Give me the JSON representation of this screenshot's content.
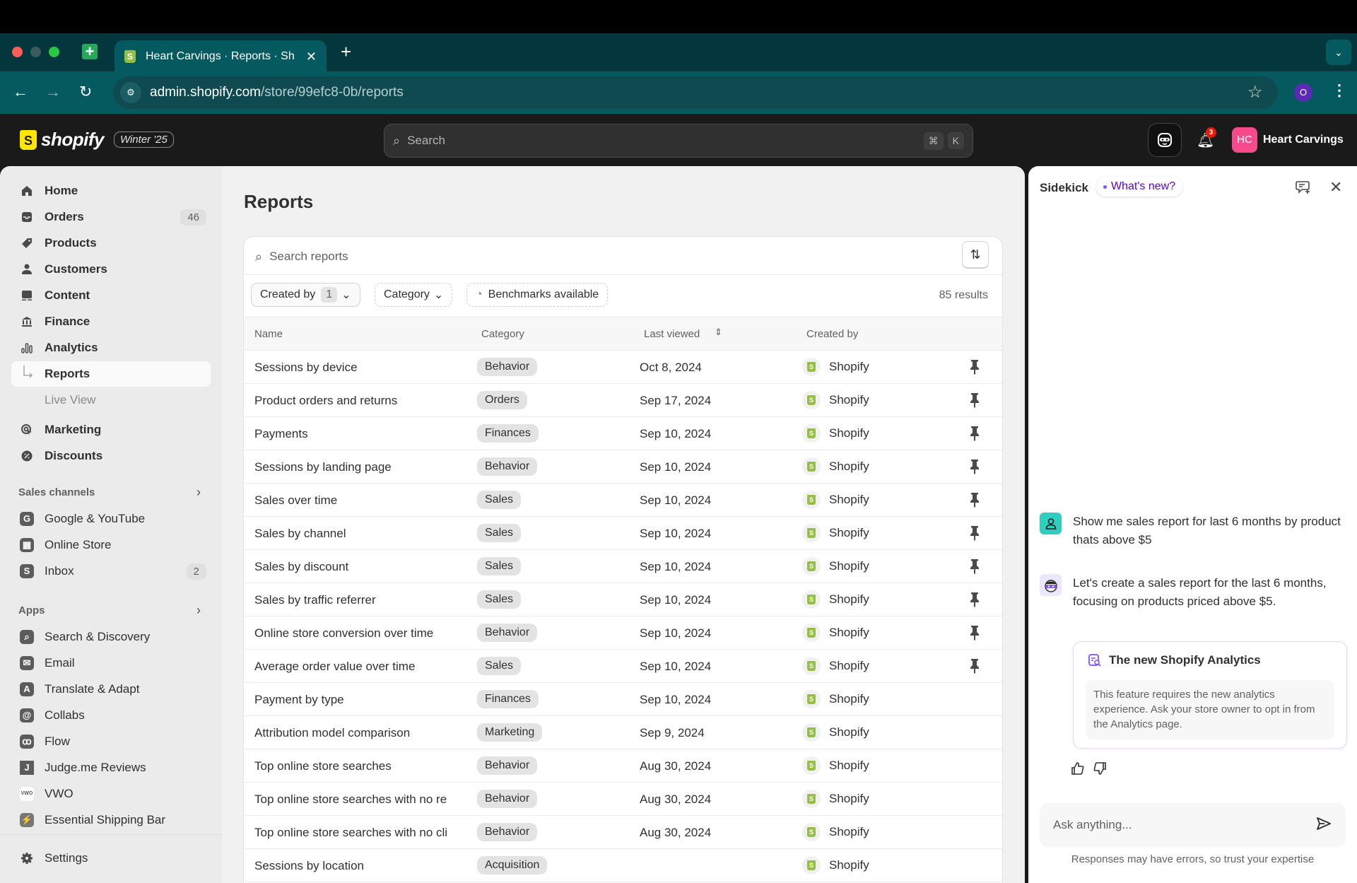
{
  "browser": {
    "tab_title": "Heart Carvings · Reports · Shopify",
    "tab_title_visible": "Heart Carvings · Reports · Sh",
    "new_tab_label": "+",
    "url_domain": "admin.shopify.com",
    "url_path": "/store/99efc8-0b/reports",
    "profile_initial": "O"
  },
  "header": {
    "logo_text": "shopify",
    "edition_badge": "Winter '25",
    "search_placeholder": "Search",
    "shortcut_keys": [
      "⌘",
      "K"
    ],
    "notification_count": "3",
    "store_initials": "HC",
    "store_name": "Heart Carvings"
  },
  "sidebar": {
    "items": [
      {
        "label": "Home",
        "icon": "home-icon"
      },
      {
        "label": "Orders",
        "icon": "orders-icon",
        "count": "46"
      },
      {
        "label": "Products",
        "icon": "tag-icon"
      },
      {
        "label": "Customers",
        "icon": "person-icon"
      },
      {
        "label": "Content",
        "icon": "content-icon"
      },
      {
        "label": "Finance",
        "icon": "bank-icon"
      },
      {
        "label": "Analytics",
        "icon": "bar-chart-icon"
      },
      {
        "label": "Reports",
        "active": true
      },
      {
        "label": "Live View"
      },
      {
        "label": "Marketing",
        "icon": "target-icon"
      },
      {
        "label": "Discounts",
        "icon": "discount-icon"
      }
    ],
    "sales_channels_heading": "Sales channels",
    "sales_channels": [
      {
        "label": "Google & YouTube",
        "icon": "google-icon"
      },
      {
        "label": "Online Store",
        "icon": "store-icon"
      },
      {
        "label": "Inbox",
        "icon": "inbox-icon",
        "count": "2"
      }
    ],
    "apps_heading": "Apps",
    "apps": [
      {
        "label": "Search & Discovery",
        "icon": "search-discovery-icon"
      },
      {
        "label": "Email",
        "icon": "email-icon"
      },
      {
        "label": "Translate & Adapt",
        "icon": "translate-icon"
      },
      {
        "label": "Collabs",
        "icon": "collabs-icon"
      },
      {
        "label": "Flow",
        "icon": "flow-icon"
      },
      {
        "label": "Judge.me Reviews",
        "icon": "judgeme-icon"
      },
      {
        "label": "VWO",
        "icon": "vwo-icon"
      },
      {
        "label": "Essential Shipping Bar",
        "icon": "shipping-bar-icon"
      }
    ],
    "settings_label": "Settings"
  },
  "main": {
    "title": "Reports",
    "search_placeholder": "Search reports",
    "filters": {
      "created_by_label": "Created by",
      "created_by_count": "1",
      "category_label": "Category",
      "benchmarks_label": "Benchmarks available"
    },
    "results_count": "85 results",
    "columns": [
      "Name",
      "Category",
      "Last viewed",
      "Created by"
    ],
    "rows": [
      {
        "name": "Sessions by device",
        "category": "Behavior",
        "last_viewed": "Oct 8, 2024",
        "created_by": "Shopify",
        "pinned": true
      },
      {
        "name": "Product orders and returns",
        "category": "Orders",
        "last_viewed": "Sep 17, 2024",
        "created_by": "Shopify",
        "pinned": true
      },
      {
        "name": "Payments",
        "category": "Finances",
        "last_viewed": "Sep 10, 2024",
        "created_by": "Shopify",
        "pinned": true
      },
      {
        "name": "Sessions by landing page",
        "category": "Behavior",
        "last_viewed": "Sep 10, 2024",
        "created_by": "Shopify",
        "pinned": true
      },
      {
        "name": "Sales over time",
        "category": "Sales",
        "last_viewed": "Sep 10, 2024",
        "created_by": "Shopify",
        "pinned": true
      },
      {
        "name": "Sales by channel",
        "category": "Sales",
        "last_viewed": "Sep 10, 2024",
        "created_by": "Shopify",
        "pinned": true
      },
      {
        "name": "Sales by discount",
        "category": "Sales",
        "last_viewed": "Sep 10, 2024",
        "created_by": "Shopify",
        "pinned": true
      },
      {
        "name": "Sales by traffic referrer",
        "category": "Sales",
        "last_viewed": "Sep 10, 2024",
        "created_by": "Shopify",
        "pinned": true
      },
      {
        "name": "Online store conversion over time",
        "category": "Behavior",
        "last_viewed": "Sep 10, 2024",
        "created_by": "Shopify",
        "pinned": true
      },
      {
        "name": "Average order value over time",
        "category": "Sales",
        "last_viewed": "Sep 10, 2024",
        "created_by": "Shopify",
        "pinned": true
      },
      {
        "name": "Payment by type",
        "category": "Finances",
        "last_viewed": "Sep 10, 2024",
        "created_by": "Shopify",
        "pinned": false
      },
      {
        "name": "Attribution model comparison",
        "category": "Marketing",
        "last_viewed": "Sep 9, 2024",
        "created_by": "Shopify",
        "pinned": false
      },
      {
        "name": "Top online store searches",
        "category": "Behavior",
        "last_viewed": "Aug 30, 2024",
        "created_by": "Shopify",
        "pinned": false
      },
      {
        "name": "Top online store searches with no re",
        "category": "Behavior",
        "last_viewed": "Aug 30, 2024",
        "created_by": "Shopify",
        "pinned": false
      },
      {
        "name": "Top online store searches with no cli",
        "category": "Behavior",
        "last_viewed": "Aug 30, 2024",
        "created_by": "Shopify",
        "pinned": false
      },
      {
        "name": "Sessions by location",
        "category": "Acquisition",
        "last_viewed": "",
        "created_by": "Shopify",
        "pinned": false
      }
    ]
  },
  "sidekick": {
    "title": "Sidekick",
    "whats_new": "What's new?",
    "messages": [
      {
        "role": "user",
        "text": "Show me sales report for last 6 months by product thats above $5"
      },
      {
        "role": "assistant",
        "text": "Let's create a sales report for the last 6 months, focusing on products priced above $5."
      }
    ],
    "card": {
      "title": "The new Shopify Analytics",
      "body": "This feature requires the new analytics experience. Ask your store owner to opt in from the Analytics page."
    },
    "input_placeholder": "Ask anything...",
    "disclaimer": "Responses may have errors, so trust your expertise"
  },
  "colors": {
    "browser_chrome": "#03363d",
    "toolbar": "#055a60",
    "shopify_green": "#95bf47",
    "sidekick_purple": "#5c00d2",
    "avatar_pink": "#f64a8c"
  }
}
